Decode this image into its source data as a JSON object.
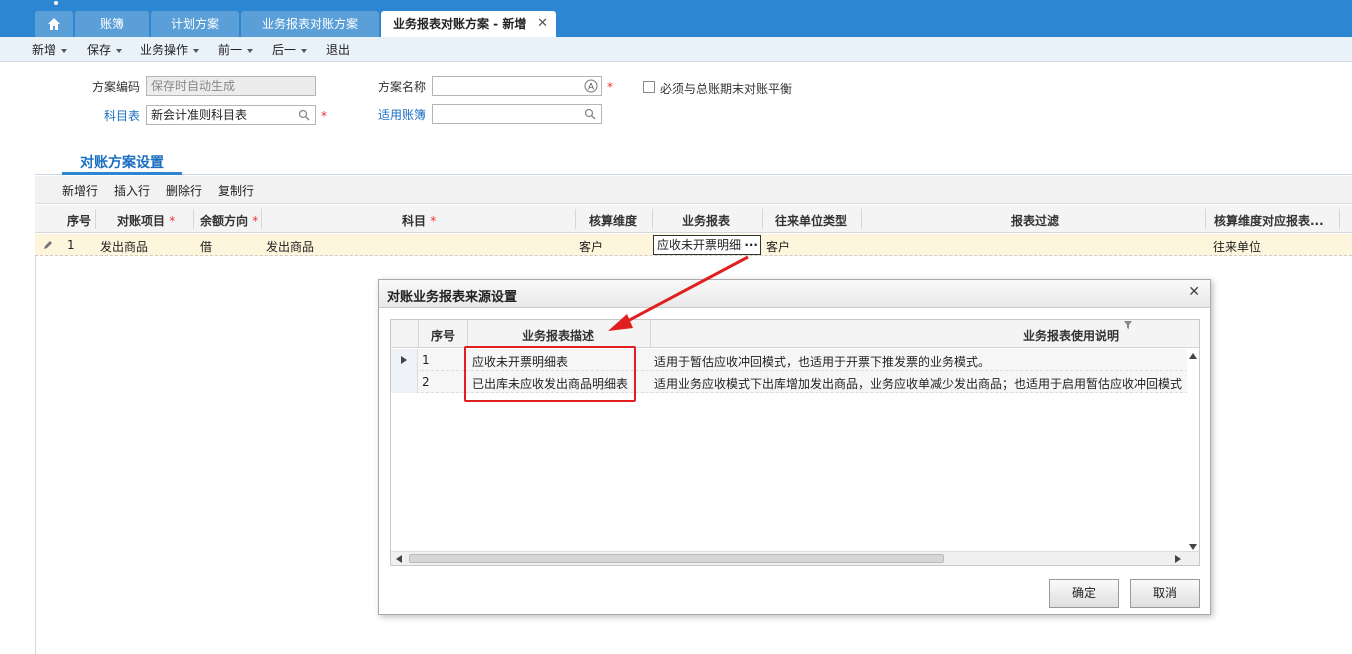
{
  "tabs": [
    {
      "label": ""
    },
    {
      "label": "账簿"
    },
    {
      "label": "计划方案"
    },
    {
      "label": "业务报表对账方案"
    },
    {
      "label": "业务报表对账方案 - 新增"
    }
  ],
  "toolbar": {
    "new": "新增",
    "save": "保存",
    "biz_ops": "业务操作",
    "prev": "前一",
    "next": "后一",
    "exit": "退出"
  },
  "form": {
    "scheme_code_label": "方案编码",
    "scheme_code_value": "保存时自动生成",
    "scheme_name_label": "方案名称",
    "scheme_name_value": "",
    "must_balance_label": "必须与总账期末对账平衡",
    "account_table_label": "科目表",
    "account_table_value": "新会计准则科目表",
    "applicable_books_label": "适用账簿",
    "applicable_books_value": "",
    "required_mark": "*"
  },
  "section": {
    "title": "对账方案设置"
  },
  "grid_toolbar": {
    "add_row": "新增行",
    "insert_row": "插入行",
    "delete_row": "删除行",
    "copy_row": "复制行"
  },
  "grid": {
    "headers": {
      "seq": "序号",
      "item": "对账项目",
      "direction": "余额方向",
      "subject": "科目",
      "dimension": "核算维度",
      "report": "业务报表",
      "partner_type": "往来单位类型",
      "filter": "报表过滤",
      "dim_map": "核算维度对应报表..."
    },
    "rows": [
      {
        "seq": "1",
        "item": "发出商品",
        "direction": "借",
        "subject": "发出商品",
        "dimension": "客户",
        "report": "应收未开票明细表",
        "report_btn": "···",
        "partner_type": "客户",
        "filter": "",
        "dim_map": "往来单位"
      }
    ]
  },
  "dialog": {
    "title": "对账业务报表来源设置",
    "headers": {
      "seq": "序号",
      "desc": "业务报表描述",
      "usage": "业务报表使用说明"
    },
    "rows": [
      {
        "seq": "1",
        "desc": "应收未开票明细表",
        "usage": "适用于暂估应收冲回模式，也适用于开票下推发票的业务模式。"
      },
      {
        "seq": "2",
        "desc": "已出库未应收发出商品明细表",
        "usage": "适用业务应收模式下出库增加发出商品，业务应收单减少发出商品；也适用于启用暂估应收冲回模式"
      }
    ],
    "ok": "确定",
    "cancel": "取消"
  },
  "colors": {
    "tabbar": "#2d86d1",
    "link": "#1a6fc2",
    "highlight_row": "#fdf5dc",
    "annotation": "#e02020"
  }
}
